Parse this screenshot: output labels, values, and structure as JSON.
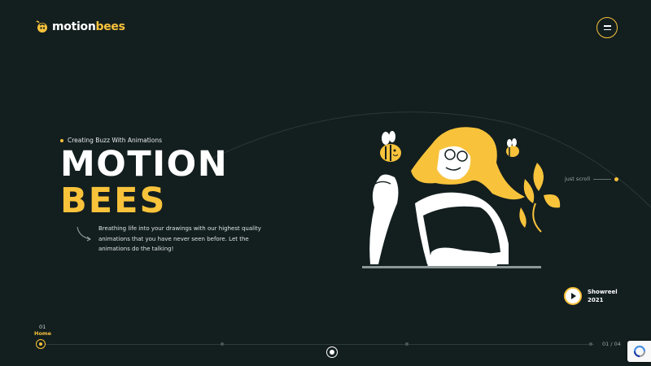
{
  "brand": {
    "prefix": "motion",
    "suffix": "bees",
    "accent": "#f8c33b",
    "background": "#131e1f"
  },
  "menu": {
    "icon": "hamburger-icon"
  },
  "hero": {
    "tagline": "Creating Buzz With Animations",
    "title_line1": "MOTION",
    "title_line2": "BEES",
    "description": "Breathing life into your drawings with our highest quality animations that you have never seen before. Let the animations do the talking!"
  },
  "scroll_hint": "just scroll",
  "showreel": {
    "label": "Showreel",
    "year": "2021",
    "icon": "play-icon"
  },
  "timeline": {
    "current_number": "01",
    "current_label": "Home",
    "pager": "01 / 04"
  },
  "recaptcha": {
    "icon": "recaptcha-icon"
  }
}
